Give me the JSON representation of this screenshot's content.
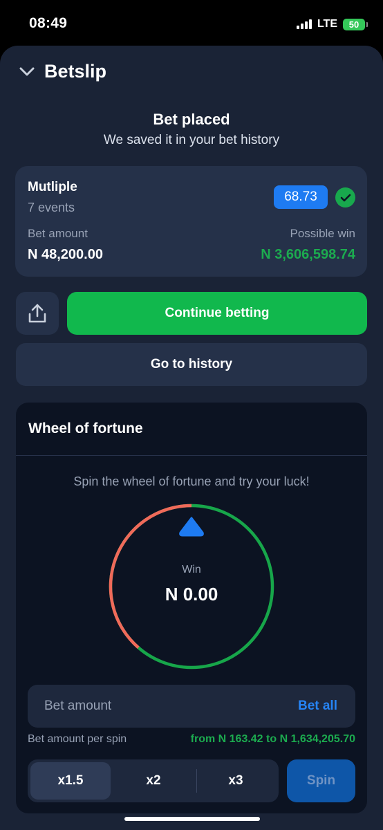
{
  "status_bar": {
    "time": "08:49",
    "network": "LTE",
    "battery": "50"
  },
  "header": {
    "title": "Betslip",
    "collapse_icon": "chevron-down-icon"
  },
  "confirmation": {
    "title": "Bet placed",
    "subtitle": "We saved it in your bet history"
  },
  "bet_summary": {
    "type": "Mutliple",
    "events": "7 events",
    "odds": "68.73",
    "status_icon": "check-icon",
    "bet_amount_label": "Bet amount",
    "bet_amount": "N 48,200.00",
    "possible_win_label": "Possible win",
    "possible_win": "N 3,606,598.74"
  },
  "actions": {
    "share_icon": "share-icon",
    "continue_label": "Continue betting",
    "history_label": "Go to history"
  },
  "wheel": {
    "title": "Wheel of fortune",
    "subtitle": "Spin the wheel of fortune and try your luck!",
    "win_label": "Win",
    "win_value": "N 0.00",
    "pointer_icon": "triangle-pointer-icon",
    "bet_amount_placeholder": "Bet amount",
    "bet_all_label": "Bet all",
    "per_spin_label": "Bet amount per spin",
    "per_spin_range": "from N 163.42 to N 1,634,205.70",
    "multipliers": [
      "x1.5",
      "x2",
      "x3"
    ],
    "selected_multiplier": "x1.5",
    "spin_label": "Spin"
  },
  "colors": {
    "accent_green": "#11b84d",
    "accent_blue": "#1e7bf2",
    "wheel_red": "#f06a5a",
    "wheel_green": "#17a64a"
  }
}
